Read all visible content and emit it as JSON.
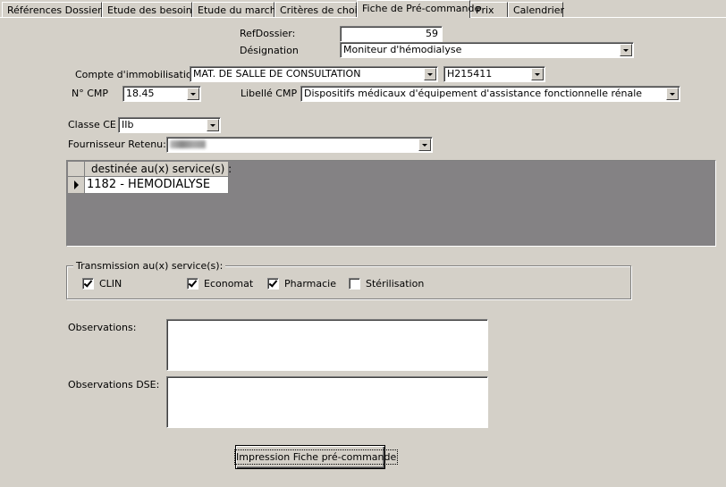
{
  "tabs": [
    {
      "label": "Références Dossier"
    },
    {
      "label": "Etude des besoins"
    },
    {
      "label": "Etude du marché"
    },
    {
      "label": "Critères de choix"
    },
    {
      "label": "Fiche de Pré-commande"
    },
    {
      "label": "Prix"
    },
    {
      "label": "Calendrier"
    }
  ],
  "active_tab": "Fiche de Pré-commande",
  "form": {
    "refdossier_label": "RefDossier:",
    "refdossier_value": "59",
    "designation_label": "Désignation",
    "designation_value": "Moniteur d'hémodialyse",
    "compte_label": "Compte d'immobilisation",
    "compte_value": "MAT. DE SALLE DE CONSULTATION",
    "compte_code_value": "H215411",
    "ncmp_label": "N° CMP",
    "ncmp_value": "18.45",
    "libelle_label": "Libellé CMP",
    "libelle_value": "Dispositifs médicaux d'équipement d'assistance fonctionnelle rénale",
    "classe_label": "Classe CE",
    "classe_value": "IIb",
    "fournisseur_label": "Fournisseur Retenu:"
  },
  "grid": {
    "column_header": "destinée au(x) service(s) :",
    "rows": [
      "1182 - HEMODIALYSE"
    ]
  },
  "transmission": {
    "title": "Transmission au(x) service(s):",
    "options": [
      {
        "label": "CLIN",
        "checked": true
      },
      {
        "label": "Economat",
        "checked": true
      },
      {
        "label": "Pharmacie",
        "checked": true
      },
      {
        "label": "Stérilisation",
        "checked": false
      }
    ]
  },
  "observations_label": "Observations:",
  "observations_dse_label": "Observations DSE:",
  "print_button_label": "Impression Fiche pré-commande"
}
